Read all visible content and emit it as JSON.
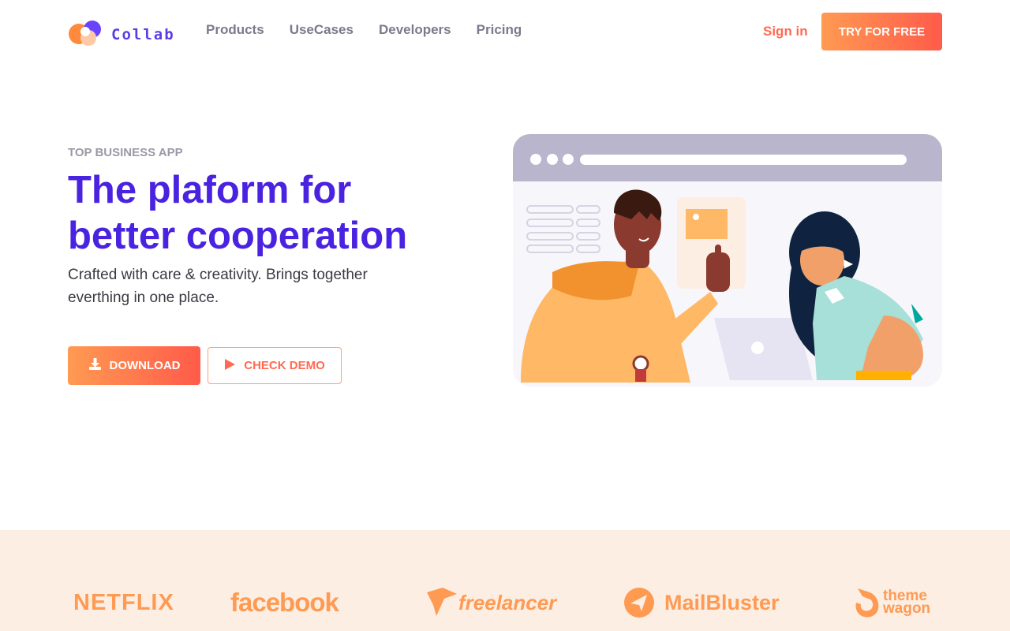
{
  "nav": {
    "logo_text": "Collab",
    "links": [
      "Products",
      "UseCases",
      "Developers",
      "Pricing"
    ],
    "signin": "Sign in",
    "cta": "TRY FOR FREE"
  },
  "hero": {
    "eyebrow": "TOP BUSINESS APP",
    "headline": "The plaform for better cooperation",
    "subtext": "Crafted with care & creativity. Brings together everthing in one place.",
    "download_label": "DOWNLOAD",
    "demo_label": "CHECK DEMO"
  },
  "brands": [
    "NETFLIX",
    "facebook",
    "freelancer",
    "MailBluster",
    "theme wagon"
  ],
  "colors": {
    "primary": "#4a23e0",
    "accent_start": "#ff9a52",
    "accent_end": "#ff5b4a",
    "brand_strip_bg": "#fdeee3"
  },
  "icons": [
    "download-icon",
    "play-icon"
  ]
}
